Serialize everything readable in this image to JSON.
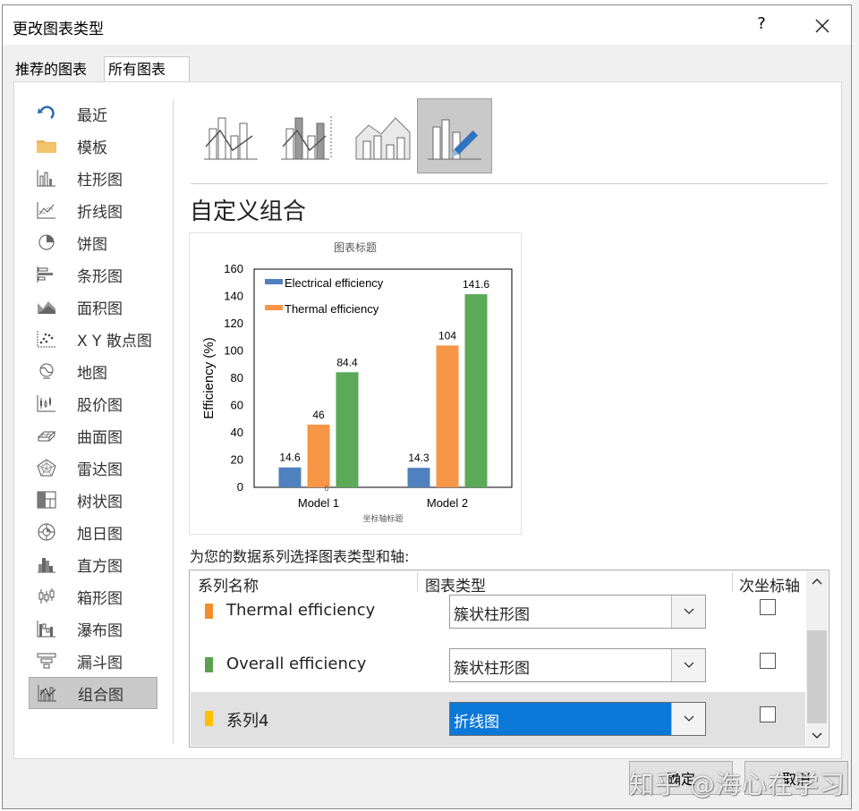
{
  "dialog": {
    "title": "更改图表类型",
    "help": "?",
    "close": "✕"
  },
  "tabs": [
    {
      "label": "推荐的图表"
    },
    {
      "label": "所有图表"
    }
  ],
  "nav": [
    {
      "label": "最近",
      "icon": "recent-icon"
    },
    {
      "label": "模板",
      "icon": "folder-icon"
    },
    {
      "label": "柱形图",
      "icon": "column-chart-icon"
    },
    {
      "label": "折线图",
      "icon": "line-chart-icon"
    },
    {
      "label": "饼图",
      "icon": "pie-chart-icon"
    },
    {
      "label": "条形图",
      "icon": "bar-chart-icon"
    },
    {
      "label": "面积图",
      "icon": "area-chart-icon"
    },
    {
      "label": "X Y 散点图",
      "icon": "scatter-chart-icon"
    },
    {
      "label": "地图",
      "icon": "map-chart-icon"
    },
    {
      "label": "股价图",
      "icon": "stock-chart-icon"
    },
    {
      "label": "曲面图",
      "icon": "surface-chart-icon"
    },
    {
      "label": "雷达图",
      "icon": "radar-chart-icon"
    },
    {
      "label": "树状图",
      "icon": "treemap-chart-icon"
    },
    {
      "label": "旭日图",
      "icon": "sunburst-chart-icon"
    },
    {
      "label": "直方图",
      "icon": "histogram-chart-icon"
    },
    {
      "label": "箱形图",
      "icon": "boxplot-chart-icon"
    },
    {
      "label": "瀑布图",
      "icon": "waterfall-chart-icon"
    },
    {
      "label": "漏斗图",
      "icon": "funnel-chart-icon"
    },
    {
      "label": "组合图",
      "icon": "combo-chart-icon"
    }
  ],
  "selected_nav": "组合图",
  "combo": {
    "title": "自定义组合",
    "prompt": "为您的数据系列选择图表类型和轴:"
  },
  "table": {
    "headers": [
      "系列名称",
      "图表类型",
      "次坐标轴"
    ],
    "rows": [
      {
        "name": "Thermal efficiency",
        "type": "簇状柱形图",
        "secondary": false,
        "color": "#f28e2b"
      },
      {
        "name": "Overall efficiency",
        "type": "簇状柱形图",
        "secondary": false,
        "color": "#59a14f"
      },
      {
        "name": "系列4",
        "type": "折线图",
        "secondary": false,
        "color": "#ffc000"
      }
    ]
  },
  "buttons": {
    "ok": "确定",
    "cancel": "取消"
  },
  "watermark": "知乎 @海心在学习",
  "chart_data": {
    "type": "bar",
    "title": "图表标题",
    "xlabel": "坐标轴标题",
    "ylabel": "Efficiency (%)",
    "ylim": [
      0,
      160
    ],
    "yticks": [
      "0",
      "20",
      "40",
      "60",
      "80",
      "100",
      "120",
      "140",
      "160"
    ],
    "categories": [
      "Model 1",
      "Model 2"
    ],
    "series": [
      {
        "name": "Electrical efficiency",
        "color": "#4e81bd",
        "values": [
          14.6,
          14.3
        ],
        "labels": [
          "14.6",
          "14.3"
        ]
      },
      {
        "name": "Thermal efficiency",
        "color": "#f79646",
        "values": [
          46,
          104
        ],
        "labels": [
          "46",
          "104"
        ]
      },
      {
        "name": "Overall efficiency",
        "color": "#5aaa57",
        "values": [
          84.4,
          141.6
        ],
        "labels": [
          "84.4",
          "141.6"
        ]
      }
    ],
    "series4_marker_label": "0",
    "legend_entries": [
      "Electrical efficiency",
      "Thermal efficiency"
    ],
    "legend_position": "top-left",
    "grid": false
  }
}
